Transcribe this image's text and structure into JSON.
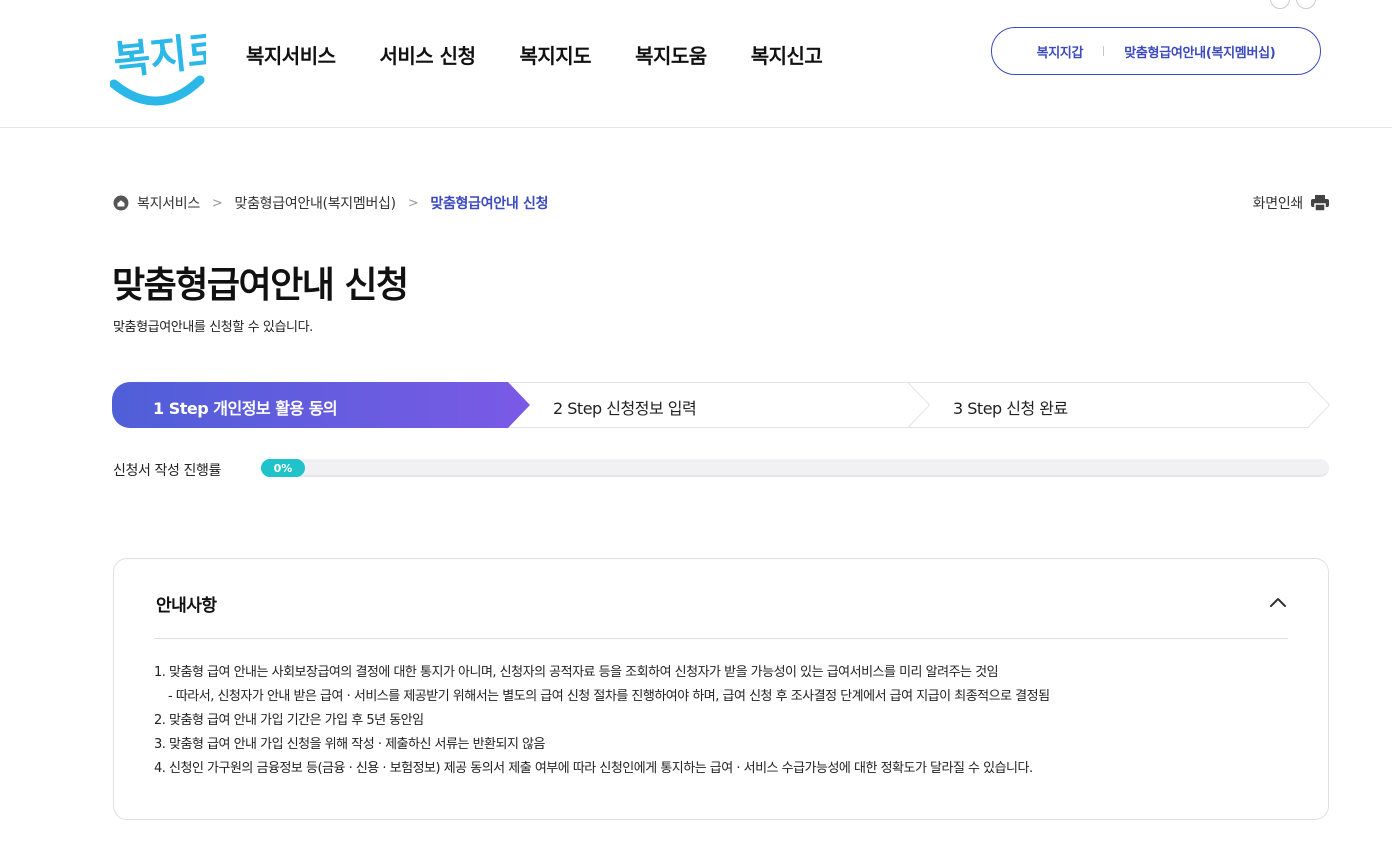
{
  "header": {
    "logo_text": "복지로",
    "nav": [
      "복지서비스",
      "서비스 신청",
      "복지지도",
      "복지도움",
      "복지신고"
    ],
    "util_links": [
      "복지지갑",
      "맞춤형급여안내(복지멤버십)"
    ]
  },
  "breadcrumb": {
    "items": [
      "복지서비스",
      "맞춤형급여안내(복지멤버십)"
    ],
    "current": "맞춤형급여안내 신청"
  },
  "print_label": "화면인쇄",
  "page": {
    "title": "맞춤형급여안내 신청",
    "description": "맞춤형급여안내를 신청할 수 있습니다."
  },
  "steps": [
    {
      "label": "1 Step 개인정보 활용 동의",
      "active": true
    },
    {
      "label": "2 Step 신청정보 입력",
      "active": false
    },
    {
      "label": "3 Step 신청 완료",
      "active": false
    }
  ],
  "progress": {
    "label": "신청서 작성 진행률",
    "value_text": "0%",
    "value": 0
  },
  "notice": {
    "title": "안내사항",
    "items": [
      "1. 맞춤형 급여 안내는 사회보장급여의 결정에 대한 통지가 아니며, 신청자의 공적자료 등을 조회하여 신청자가 받을 가능성이 있는 급여서비스를 미리 알려주는 것임",
      "- 따라서, 신청자가 안내 받은 급여 · 서비스를 제공받기 위해서는 별도의 급여 신청 절차를 진행하여야 하며, 급여 신청 후 조사결정 단계에서 급여 지급이 최종적으로 결정됨",
      "2. 맞춤형 급여 안내 가입 기간은 가입 후 5년 동안임",
      "3. 맞춤형 급여 안내 가입 신청을 위해 작성 · 제출하신 서류는 반환되지 않음",
      "4. 신청인 가구원의 금융정보 등(금융 · 신용 · 보험정보) 제공 동의서 제출 여부에 따라 신청인에게 통지하는 급여 · 서비스 수급가능성에 대한 정확도가 달라질 수 있습니다."
    ]
  },
  "colors": {
    "brand_blue": "#3b4bbf",
    "logo_cyan": "#2bb8e8",
    "step_gradient_start": "#4f5fd8",
    "step_gradient_end": "#7a5ae6",
    "progress_teal": "#1fc3c9"
  }
}
